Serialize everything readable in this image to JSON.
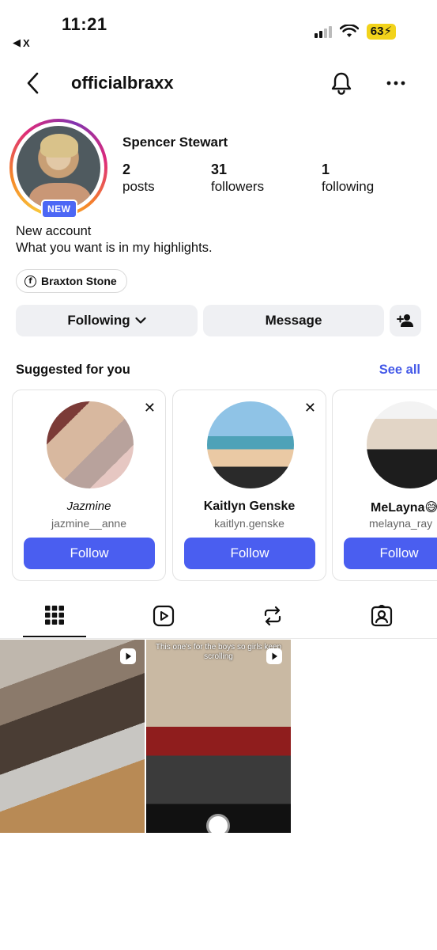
{
  "status_bar": {
    "time": "11:21",
    "back_app": "X",
    "battery": "63"
  },
  "header": {
    "username": "officialbraxx"
  },
  "profile": {
    "display_name": "Spencer Stewart",
    "badge": "NEW",
    "stats": [
      {
        "value": "2",
        "label": "posts"
      },
      {
        "value": "31",
        "label": "followers"
      },
      {
        "value": "1",
        "label": "following"
      }
    ],
    "bio_line1": "New account",
    "bio_line2": "What you want is in my highlights.",
    "linked_account": "Braxton Stone"
  },
  "actions": {
    "following": "Following",
    "message": "Message"
  },
  "suggested": {
    "title": "Suggested for you",
    "see_all": "See all",
    "cards": [
      {
        "name": "Jazmine",
        "handle": "jazmine__anne",
        "follow": "Follow"
      },
      {
        "name": "Kaitlyn Genske",
        "handle": "kaitlyn.genske",
        "follow": "Follow"
      },
      {
        "name": "MeLayna😅",
        "handle": "melayna_ray",
        "follow": "Follow"
      }
    ]
  },
  "tabs": [
    "grid-icon",
    "reels-icon",
    "reposts-icon",
    "tagged-icon"
  ],
  "posts": [
    {
      "type": "reel",
      "caption": ""
    },
    {
      "type": "reel",
      "caption": "This one's for the boys so girls keep scrolling"
    }
  ],
  "colors": {
    "accent": "#4a5ef0",
    "link": "#4459e8",
    "button_bg": "#eff0f3"
  }
}
